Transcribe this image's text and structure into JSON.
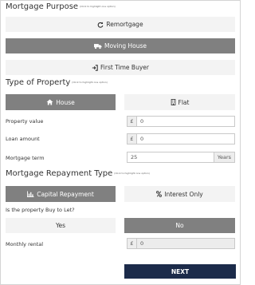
{
  "mortgage_purpose": {
    "heading": "Mortgage Purpose",
    "hint": "(Click to highlight one option)",
    "options": [
      {
        "label": "Remortgage",
        "icon": "refresh-icon",
        "selected": false
      },
      {
        "label": "Moving House",
        "icon": "truck-icon",
        "selected": true
      },
      {
        "label": "First Time Buyer",
        "icon": "sign-in-icon",
        "selected": false
      }
    ]
  },
  "property_type": {
    "heading": "Type of Property",
    "hint": "(Click to highlight one option)",
    "options": [
      {
        "label": "House",
        "icon": "home-icon",
        "selected": true
      },
      {
        "label": "Flat",
        "icon": "building-icon",
        "selected": false
      }
    ]
  },
  "fields": {
    "property_value": {
      "label": "Property value",
      "prefix": "£",
      "value": "0"
    },
    "loan_amount": {
      "label": "Loan amount",
      "prefix": "£",
      "value": "0"
    },
    "mortgage_term": {
      "label": "Mortgage term",
      "value": "25",
      "suffix": "Years"
    }
  },
  "repayment_type": {
    "heading": "Mortgage Repayment Type",
    "hint": "(Click to highlight one option)",
    "options": [
      {
        "label": "Capital Repayment",
        "icon": "bar-chart-icon",
        "selected": true
      },
      {
        "label": "Interest Only",
        "icon": "percent-icon",
        "selected": false
      }
    ]
  },
  "buy_to_let": {
    "question": "Is the property Buy to Let?",
    "options": [
      {
        "label": "Yes",
        "selected": false
      },
      {
        "label": "No",
        "selected": true
      }
    ]
  },
  "monthly_rental": {
    "label": "Monthly rental",
    "prefix": "£",
    "value": "0",
    "disabled": true
  },
  "next_button": {
    "label": "NEXT"
  },
  "colors": {
    "selected_bg": "#808080",
    "unselected_bg": "#f3f3f3",
    "next_bg": "#1c2b4a"
  }
}
